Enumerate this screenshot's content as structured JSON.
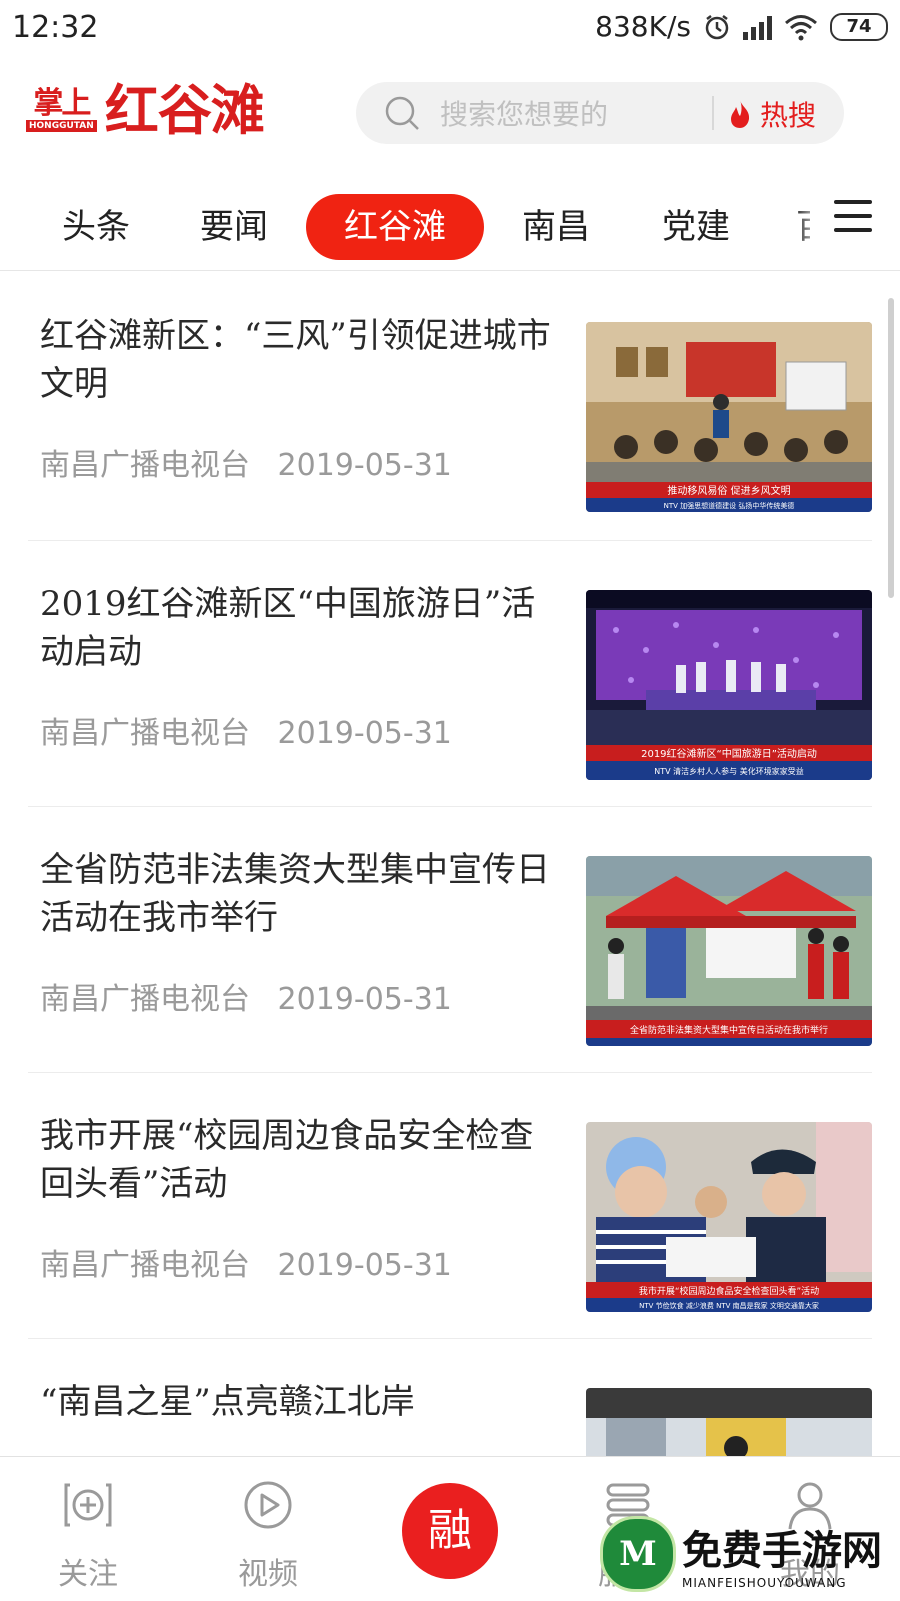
{
  "status_bar": {
    "time": "12:32",
    "speed": "838K/s",
    "battery": "74"
  },
  "header": {
    "logo_small": "掌上",
    "logo_en": "HONGGUTAN",
    "logo_big": "红谷滩",
    "search_placeholder": "搜索您想要的",
    "hot_label": "热搜"
  },
  "tabs": [
    {
      "label": "头条",
      "active": false
    },
    {
      "label": "要闻",
      "active": false
    },
    {
      "label": "红谷滩",
      "active": true
    },
    {
      "label": "南昌",
      "active": false
    },
    {
      "label": "党建",
      "active": false
    },
    {
      "label": "百",
      "active": false
    }
  ],
  "news": [
    {
      "title": "红谷滩新区：“三风”引领促进城市文明",
      "source": "南昌广播电视台",
      "date": "2019-05-31",
      "thumb_caption": "推动移风易俗 促进乡风文明",
      "thumb_ticker": "NTV 加强思想道德建设 弘扬中华传统美德"
    },
    {
      "title": "2019红谷滩新区“中国旅游日”活动启动",
      "source": "南昌广播电视台",
      "date": "2019-05-31",
      "thumb_caption": "2019红谷滩新区“中国旅游日”活动启动",
      "thumb_ticker": "NTV 清洁乡村人人参与 美化环境家家受益"
    },
    {
      "title": "全省防范非法集资大型集中宣传日活动在我市举行",
      "source": "南昌广播电视台",
      "date": "2019-05-31",
      "thumb_caption": "全省防范非法集资大型集中宣传日活动在我市举行",
      "thumb_ticker": ""
    },
    {
      "title": "我市开展“校园周边食品安全检查回头看”活动",
      "source": "南昌广播电视台",
      "date": "2019-05-31",
      "thumb_caption": "我市开展“校园周边食品安全检查回头看”活动",
      "thumb_ticker": "NTV 节俭饮食 减少浪费 NTV 南昌是我家 文明交通靠大家"
    },
    {
      "title": "“南昌之星”点亮赣江北岸",
      "source": "",
      "date": "",
      "thumb_caption": "",
      "thumb_ticker": ""
    }
  ],
  "bottom_nav": {
    "follow": "关注",
    "video": "视频",
    "center": "融",
    "service": "服务",
    "mine": "我的"
  },
  "watermark": {
    "cn": "免费手游网",
    "en": "MIANFEISHOUYOUWANG"
  },
  "colors": {
    "brand_red": "#f02312",
    "text_dark": "#2a2a2a",
    "text_gray": "#9a9a9a"
  }
}
